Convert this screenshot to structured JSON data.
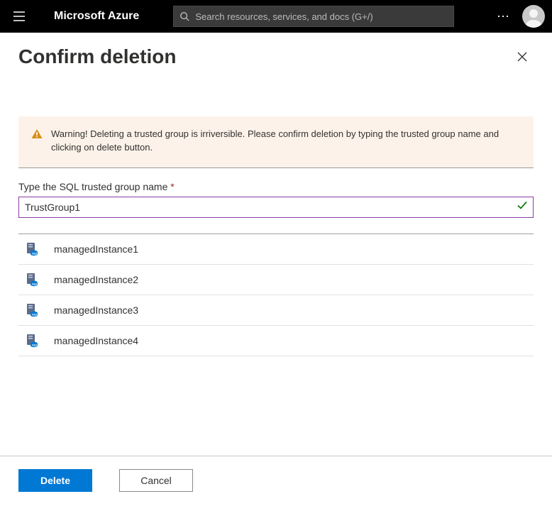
{
  "topbar": {
    "brand": "Microsoft Azure",
    "search_placeholder": "Search resources, services, and docs (G+/)"
  },
  "panel": {
    "title": "Confirm deletion"
  },
  "warning": {
    "text": "Warning! Deleting a trusted group is irriversible. Please confirm deletion by typing the trusted group name and clicking on delete button."
  },
  "field": {
    "label": "Type the SQL trusted group name",
    "required_marker": "*",
    "value": "TrustGroup1"
  },
  "instances": [
    {
      "name": "managedInstance1"
    },
    {
      "name": "managedInstance2"
    },
    {
      "name": "managedInstance3"
    },
    {
      "name": "managedInstance4"
    }
  ],
  "footer": {
    "delete_label": "Delete",
    "cancel_label": "Cancel"
  }
}
